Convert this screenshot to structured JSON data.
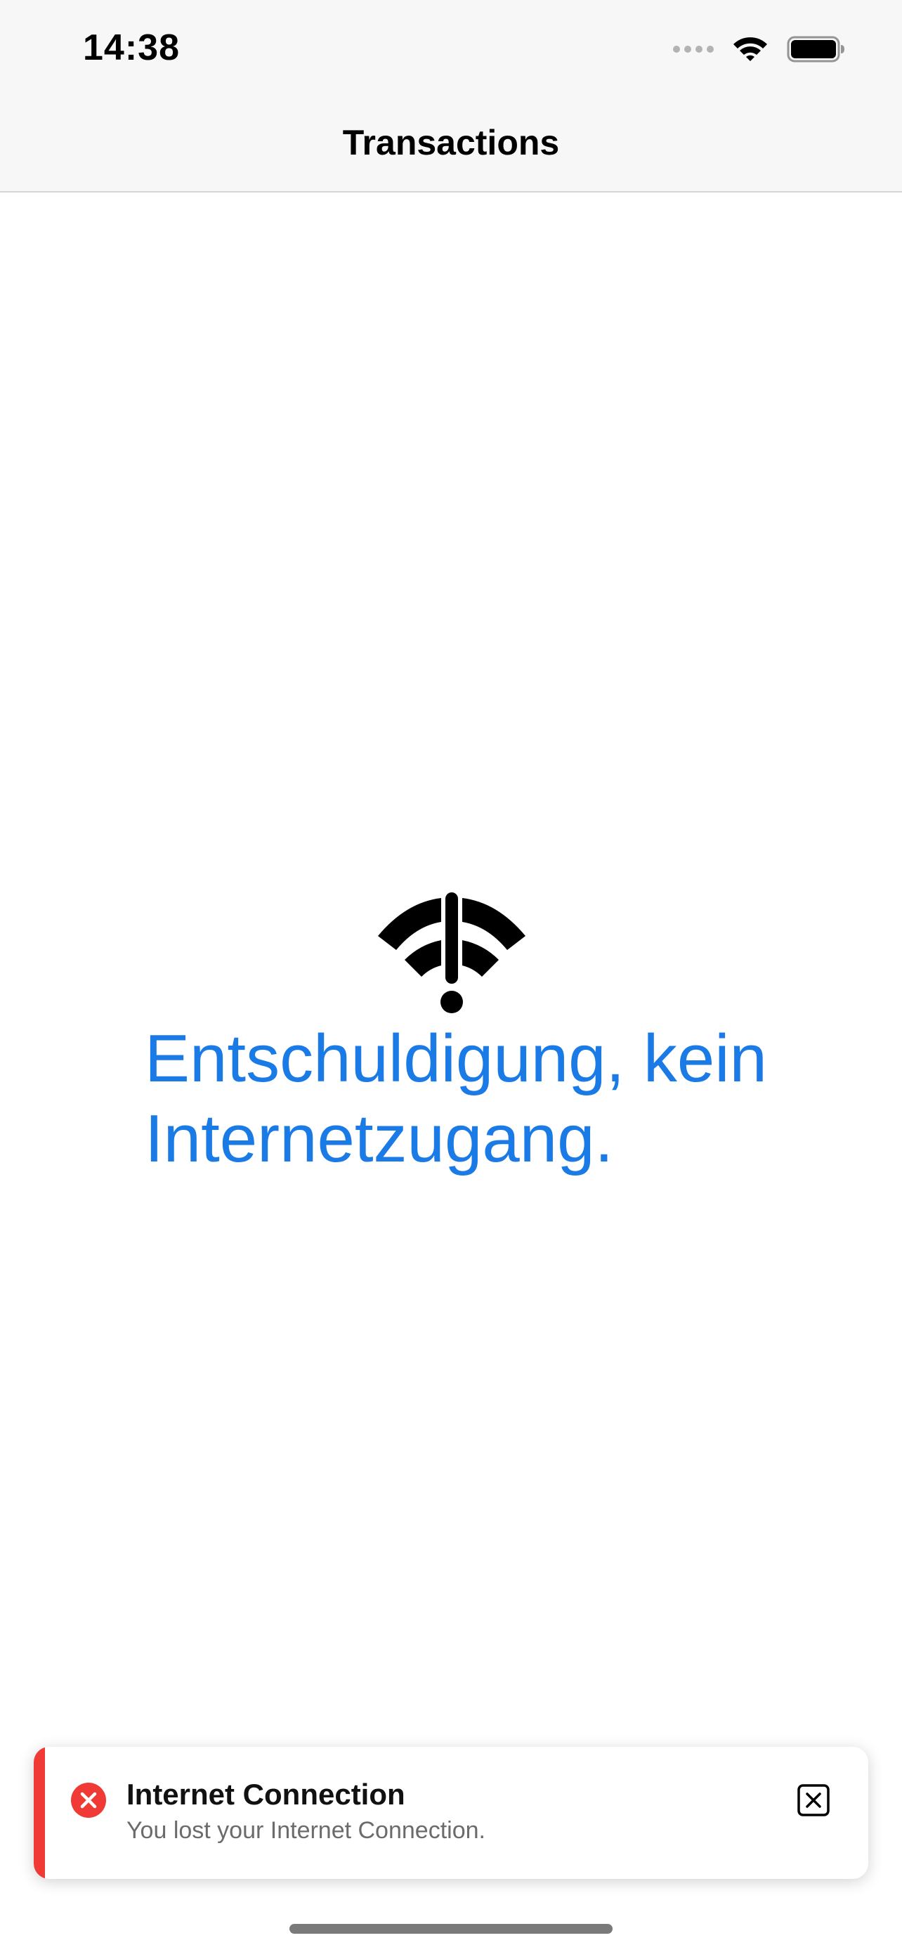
{
  "status_bar": {
    "time": "14:38",
    "icons": [
      "signal-dots-icon",
      "wifi-icon",
      "battery-icon"
    ]
  },
  "nav": {
    "title": "Transactions"
  },
  "empty_state": {
    "icon": "wifi-exclamation-icon",
    "message": "Entschuldigung, kein Internetzugang."
  },
  "toast": {
    "icon": "error-icon",
    "title": "Internet Connection",
    "message": "You lost your Internet Connection.",
    "close_icon": "close-box-icon",
    "accent_color": "#f03a35"
  },
  "colors": {
    "accent_blue": "#1a7ae6",
    "error_red": "#f03a35"
  }
}
